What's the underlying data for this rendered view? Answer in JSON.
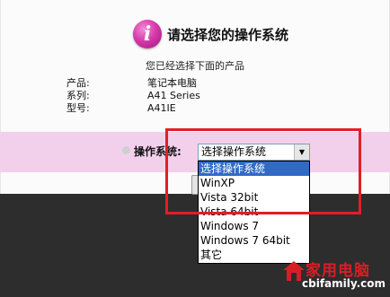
{
  "header": {
    "icon": "info-icon",
    "icon_glyph": "i",
    "title": "请选择您的操作系统"
  },
  "subtitle": "您已经选择下面的产品",
  "product_info": [
    {
      "label": "产品:",
      "value": "笔记本电脑"
    },
    {
      "label": "系列:",
      "value": "A41 Series"
    },
    {
      "label": "型号:",
      "value": "A41IE"
    }
  ],
  "os_selector": {
    "label": "操作系统:",
    "selected": "选择操作系统",
    "options": [
      "选择操作系统",
      "WinXP",
      "Vista 32bit",
      "Vista 64bit",
      "Windows 7",
      "Windows 7 64bit",
      "其它"
    ],
    "highlighted_index": 0
  },
  "watermark": {
    "title": "家用电脑",
    "domain": "cbifamily.com"
  },
  "colors": {
    "accent_pink": "#f2d0ec",
    "highlight_red": "#e01f26",
    "selection_blue": "#316ac5",
    "footer_dark": "#2d2d2d"
  }
}
